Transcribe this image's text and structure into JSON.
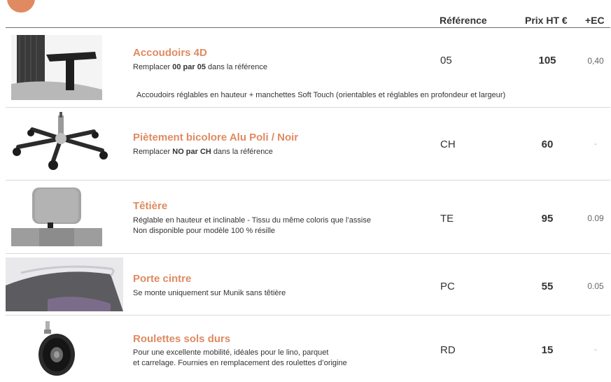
{
  "header": {
    "reference_label": "Référence",
    "price_label": "Prix HT €",
    "ec_label": "+EC"
  },
  "options": [
    {
      "title": "Accoudoirs 4D",
      "desc_pre": "Remplacer ",
      "desc_bold": "00 par 05",
      "desc_post": " dans la référence",
      "reference": "05",
      "price": "105",
      "ec": "0,40",
      "note": "Accoudoirs réglables en hauteur + manchettes Soft Touch (orientables et réglables en profondeur et largeur)",
      "image_icon": "armrest-icon"
    },
    {
      "title": "Piètement bicolore Alu Poli / Noir",
      "desc_pre": "Remplacer ",
      "desc_bold": "NO par CH",
      "desc_post": " dans la référence",
      "reference": "CH",
      "price": "60",
      "ec": "-",
      "image_icon": "chair-base-icon"
    },
    {
      "title": "Têtière",
      "desc_line1": "Réglable en hauteur et inclinable - Tissu du même coloris que l’assise",
      "desc_line2": "Non disponible pour modèle 100 % résille",
      "reference": "TE",
      "price": "95",
      "ec": "0.09",
      "image_icon": "headrest-icon"
    },
    {
      "title": "Porte cintre",
      "desc_line1": "Se monte uniquement sur Munik sans têtière",
      "reference": "PC",
      "price": "55",
      "ec": "0.05",
      "image_icon": "coat-hanger-icon"
    },
    {
      "title": "Roulettes sols durs",
      "desc_line1": "Pour une excellente mobilité, idéales pour le lino, parquet",
      "desc_line2": "et carrelage. Fournies en remplacement des roulettes d’origine",
      "reference": "RD",
      "price": "15",
      "ec": "-",
      "image_icon": "caster-wheel-icon"
    }
  ],
  "colors": {
    "accent": "#e08a62",
    "text": "#333333",
    "rule": "#d9d9d9"
  }
}
